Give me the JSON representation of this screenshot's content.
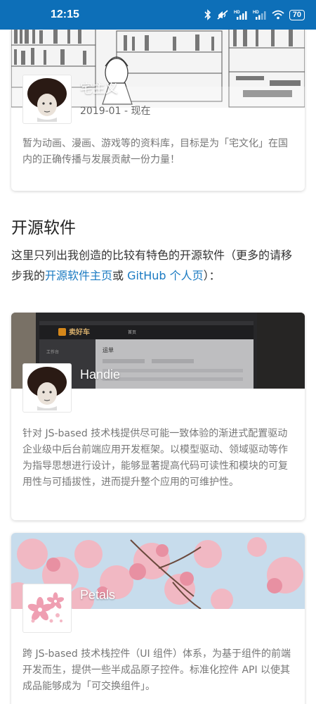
{
  "status_bar": {
    "time": "12:15",
    "icons": [
      "bluetooth-icon",
      "mute-icon",
      "signal-hd-icon",
      "signal-hd-icon",
      "wifi-icon"
    ],
    "battery": "70"
  },
  "cards": [
    {
      "title": "宅主义",
      "date": "2019-01 - 现在",
      "description": "暂为动画、漫画、游戏等的资料库，目标是为「宅文化」在国内的正确传播与发展贡献一份力量！"
    },
    {
      "title": "Handie",
      "description": "针对 JS-based 技术栈提供尽可能一致体验的渐进式配置驱动企业级中后台前端应用开发框架。以模型驱动、领域驱动等作为指导思想进行设计，能够显著提高代码可读性和模块的可复用性与可插拔性，进而提升整个应用的可维护性。"
    },
    {
      "title": "Petals",
      "description": "跨 JS-based 技术栈控件（UI 组件）体系，为基于组件的前端开发而生，提供一些半成品原子控件。标准化控件 API 以使其成品能够成为「可交换组件」。"
    }
  ],
  "section": {
    "title": "开源软件",
    "intro_prefix": "这里只列出我创造的比较有特色的开源软件（更多的请移步我的",
    "link_projects": "开源软件主页",
    "intro_or": "或 ",
    "link_github": "GitHub 个人页",
    "intro_suffix": "）："
  },
  "handie_screenshot": {
    "brand": "卖好车",
    "menu_1": "工作台",
    "menu_2": "运单",
    "tab": "首页"
  },
  "colors": {
    "status_bar": "#0d6fb8",
    "link": "#1a7ac2"
  }
}
